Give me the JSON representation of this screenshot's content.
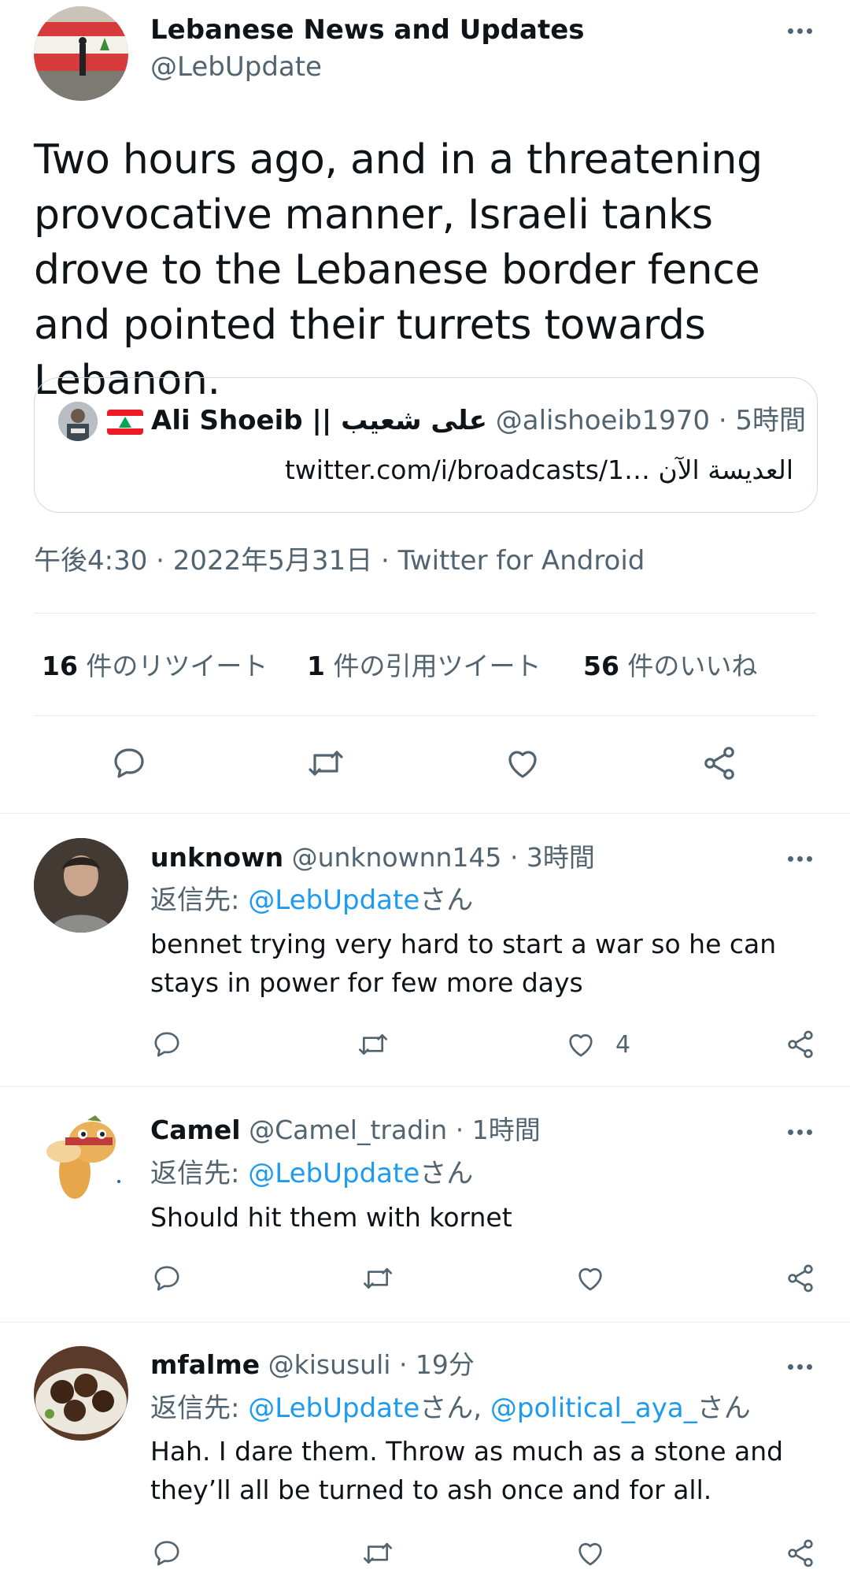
{
  "main_tweet": {
    "display_name": "Lebanese News and Updates",
    "handle": "@LebUpdate",
    "text": "Two hours ago, and in a threatening provocative manner, Israeli tanks drove to the Lebanese border fence and pointed their turrets towards Lebanon.",
    "quote": {
      "display_name": "Ali Shoeib || علی شعیب",
      "handle": "@alishoeib1970",
      "time": "· 5時間",
      "text": "twitter.com/i/broadcasts/1…  العديسة الآن"
    },
    "meta": "午後4:30 · 2022年5月31日 · Twitter for Android",
    "stats": {
      "retweets_count": "16",
      "retweets_label": " 件のリツイート",
      "quotes_count": "1",
      "quotes_label": " 件の引用ツイート",
      "likes_count": "56",
      "likes_label": " 件のいいね"
    }
  },
  "replies": [
    {
      "display_name": "unknown",
      "handle": "@unknownn145",
      "time": "· 3時間",
      "reply_prefix": "返信先: ",
      "reply_to_1": "@LebUpdate",
      "reply_suffix_1": "さん",
      "reply_to_2": "",
      "reply_suffix_2": "",
      "text": "bennet trying very hard to start a war so he can stays in power for few more days",
      "like_count": "4"
    },
    {
      "display_name": "Camel",
      "handle": "@Camel_tradin",
      "time": "· 1時間",
      "reply_prefix": "返信先: ",
      "reply_to_1": "@LebUpdate",
      "reply_suffix_1": "さん",
      "reply_to_2": "",
      "reply_suffix_2": "",
      "text": "Should hit them with kornet",
      "like_count": ""
    },
    {
      "display_name": "mfalme",
      "handle": "@kisusuli",
      "time": "· 19分",
      "reply_prefix": "返信先: ",
      "reply_to_1": "@LebUpdate",
      "reply_suffix_1": "さん, ",
      "reply_to_2": "@political_aya_",
      "reply_suffix_2": "さん",
      "text": "Hah. I dare them. Throw as much as a stone and they’ll all be turned to ash once and for all.",
      "like_count": ""
    }
  ],
  "icons": [
    "more-icon",
    "reply-icon",
    "retweet-icon",
    "like-icon",
    "share-icon",
    "lebanon-flag-icon"
  ],
  "colors": {
    "link": "#1d9bf0",
    "muted": "#536471",
    "text": "#0f1419",
    "divider": "#e6ecf0"
  }
}
